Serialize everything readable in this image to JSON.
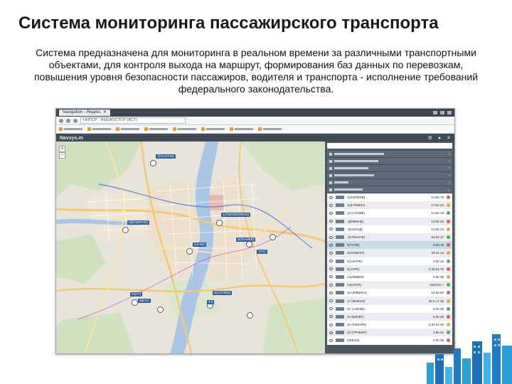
{
  "slide": {
    "title": "Система мониторинга пассажирского транспорта",
    "description": "Система предназначена для мониторинга в реальном времени за различными транспортными объектами, для контроля выхода на маршрут, формирования баз данных по перевозкам, повышения уровня безопасности пассажиров, водителя и транспорта - исполнение требований федерального законодательства."
  },
  "screenshot": {
    "browser_tab": "Navigation - Яндекс",
    "address": "НИПСР · ФЕЕЖОСТОР (ВСТ)",
    "app_brand": "Navsys.m",
    "icons": [
      "gear-icon",
      "user-icon",
      "close-icon"
    ],
    "vehicles": [
      {
        "route": "1(Х1РК8ХВ)",
        "time": "12:55 76"
      },
      {
        "route": "11(ГАРБМУ)",
        "time": "17:54 34"
      },
      {
        "route": "13 (АЛАМЕ)",
        "time": "12:55 19"
      },
      {
        "route": "-(ВМЕКНЕ)",
        "time": "12:55 23"
      },
      {
        "route": "-(В21ЕНД)",
        "time": "12:55 23"
      },
      {
        "route": "-(К7М1АНЕ)",
        "time": "04:02 17"
      },
      {
        "route": "0(7АПЕ)",
        "time": "2:00 16"
      },
      {
        "route": "0(ОАКЕНО)",
        "time": "25:41 14"
      },
      {
        "route": "0(АЗАРЖ)",
        "time": "2:00 16"
      },
      {
        "route": "0(ААРЕ)",
        "time": "2:35 51 76"
      },
      {
        "route": "14(АЕВЕИ)",
        "time": "2:00 36"
      },
      {
        "route": "14(АЛАР)",
        "time": "1520 51 7"
      },
      {
        "route": "15 (2МБЕЕХ)",
        "time": "12:55 56"
      },
      {
        "route": "17 (МОКОЛ)",
        "time": "20:4 17 36"
      },
      {
        "route": "2С (А2ОЗВ)",
        "time": "2:00 36"
      },
      {
        "route": "21 (Б2ОВГ)",
        "time": "2:00 36"
      },
      {
        "route": "32 (Р2МАРК)",
        "time": "2:35 51 36"
      },
      {
        "route": "2З (ТЯЧЕБР)",
        "time": "1:55 31"
      },
      {
        "route": "2(КВ:22)",
        "time": "2:00 36"
      }
    ],
    "map_labels": [
      "7(71А4715)",
      "2(ВТ3ОРНО)",
      "1(7ОЕУ8ЗОЛ2Н1)",
      "7(Т1)",
      "(15-В3)",
      "3(7ЕАИЕВ)",
      "8(1747803)",
      "3 0",
      "21(Т7)",
      "36(А7)"
    ]
  }
}
